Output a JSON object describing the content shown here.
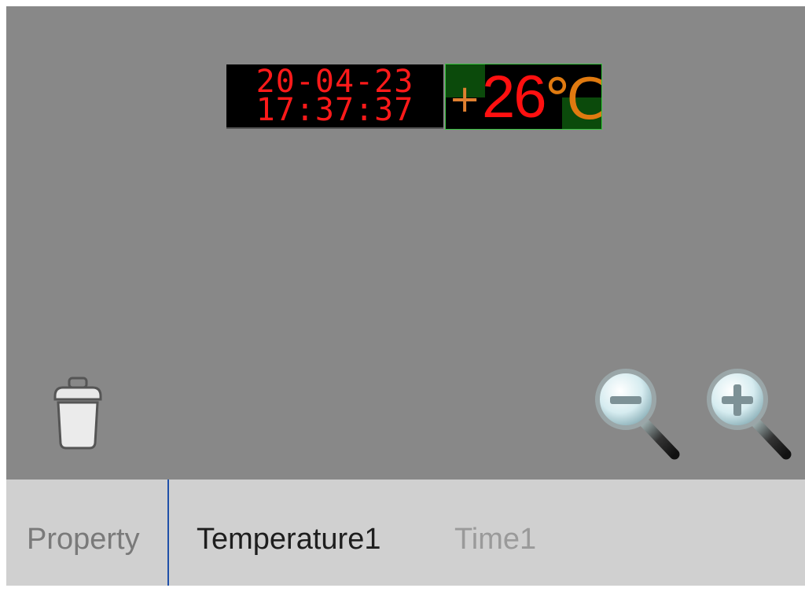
{
  "display": {
    "date": "20-04-23",
    "time": "17:37:37",
    "datetime_color": "#ff1a1a",
    "temperature_sign": "+",
    "temperature_value": "26",
    "temperature_unit": "℃",
    "sign_color": "#e08030",
    "value_color": "#ff1010",
    "unit_color": "#e07a10",
    "frame_color": "#39c23f"
  },
  "toolbar": {
    "delete_icon": "trash-icon",
    "zoom_out_icon": "zoom-out-icon",
    "zoom_in_icon": "zoom-in-icon"
  },
  "tabs": [
    {
      "label": "Property",
      "color": "#7a7a7a"
    },
    {
      "label": "Temperature1",
      "color": "#1e1e1e"
    },
    {
      "label": "Time1",
      "color": "#9a9a9a"
    }
  ],
  "colors": {
    "canvas": "#888888",
    "tabbar": "#d0d0d0",
    "divider": "#1f4fa8"
  }
}
